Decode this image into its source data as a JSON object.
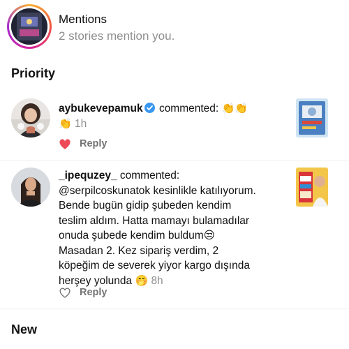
{
  "mentions": {
    "title": "Mentions",
    "subtitle": "2 stories mention you."
  },
  "sections": {
    "priority": "Priority",
    "new": "New"
  },
  "comments": [
    {
      "username": "aybukevepamuk",
      "verified": true,
      "action": "commented:",
      "emoji": "👏👏",
      "emoji2": "👏",
      "time": "1h",
      "liked": true,
      "reply_label": "Reply"
    },
    {
      "username": "_ipequzey_",
      "verified": false,
      "action": "commented:",
      "lines": [
        "@serpilcoskunatok kesinlikle katılıyorum.",
        "Bende bugün gidip şubeden kendim",
        "teslim aldım. Hatta mamayı bulamadılar",
        "onuda şubede kendim buldum😒",
        "Masadan 2. Kez sipariş verdim, 2",
        "köpeğim de severek yiyor kargo dışında",
        "herşey yolunda"
      ],
      "emoji": "🤭",
      "time": "8h",
      "liked": false,
      "reply_label": "Reply"
    }
  ],
  "colors": {
    "heart_liked": "#ed4956",
    "verified": "#3897f0",
    "secondary_text": "#8e8e8e"
  }
}
